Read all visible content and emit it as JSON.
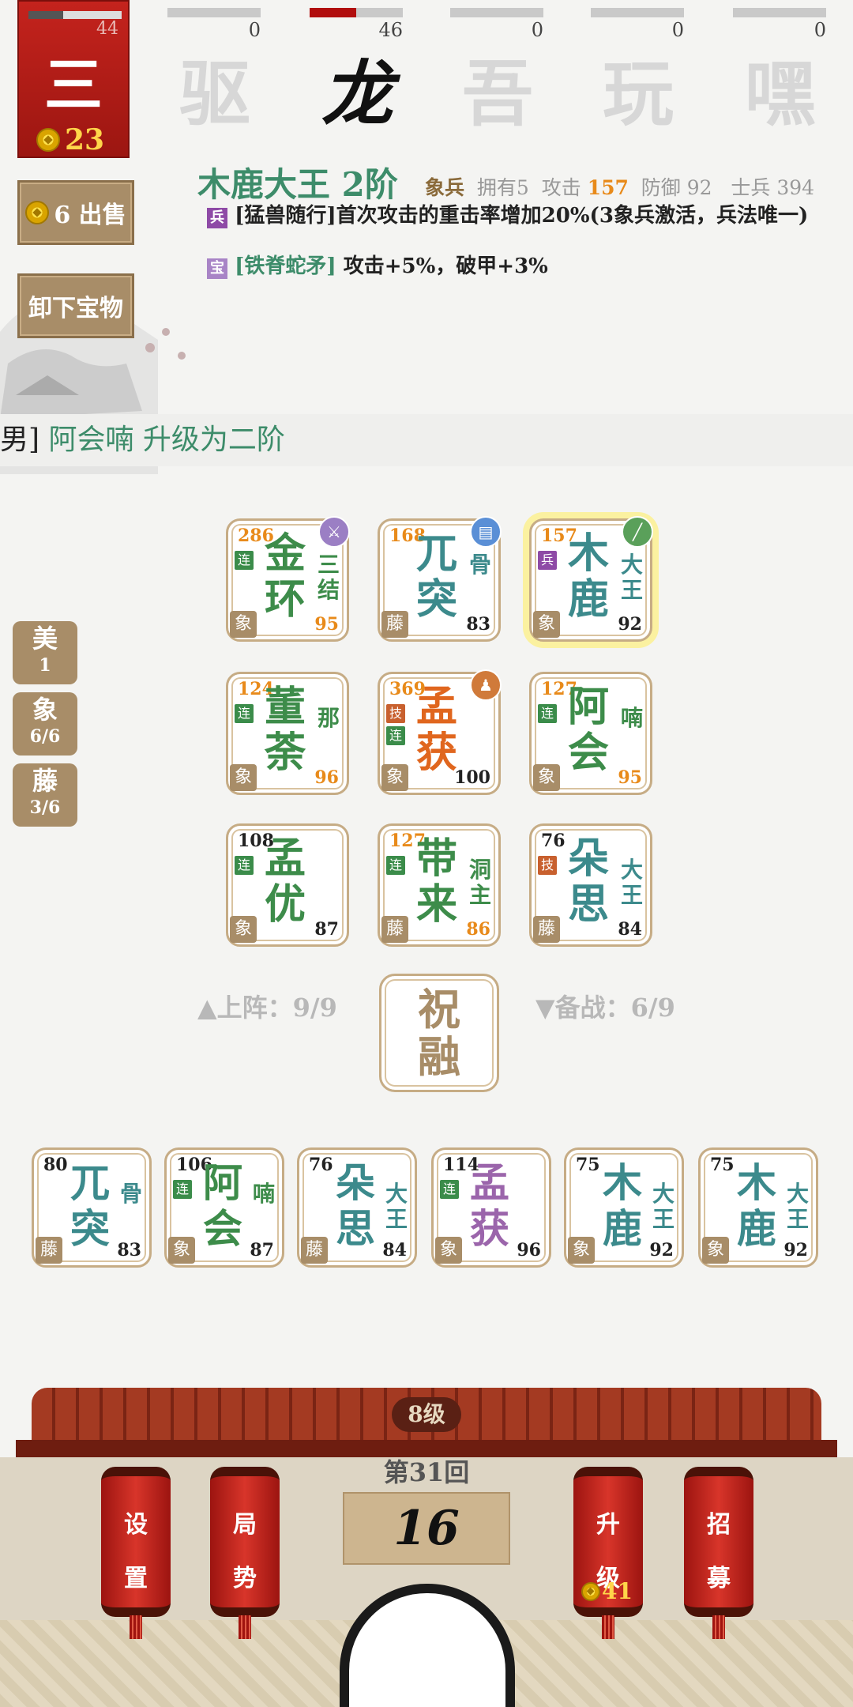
{
  "player": {
    "name": "三",
    "hp": "44",
    "hp_ratio": 0.37,
    "gold": "23"
  },
  "opponents": [
    {
      "name": "驱",
      "hp": "0",
      "hp_ratio": 0,
      "active": false
    },
    {
      "name": "龙",
      "hp": "46",
      "hp_ratio": 0.5,
      "active": true
    },
    {
      "name": "吾",
      "hp": "0",
      "hp_ratio": 0,
      "active": false
    },
    {
      "name": "玩",
      "hp": "0",
      "hp_ratio": 0,
      "active": false
    },
    {
      "name": "嘿",
      "hp": "0",
      "hp_ratio": 0,
      "active": false
    }
  ],
  "side_buttons": {
    "sell": "6 出售",
    "unequip": "卸下宝物"
  },
  "unit_info": {
    "title": "木鹿大王 2阶",
    "type_label": "象兵",
    "own_label": "拥有5",
    "atk_label": "攻击",
    "atk": "157",
    "def_label": "防御 92",
    "soldier_label": "士兵 394",
    "skill_tag": "兵",
    "skill_name": "[猛兽随行]",
    "skill_desc": "首次攻击的重击率增加20%(3象兵激活，兵法唯一)",
    "treasure_tag": "宝",
    "treasure_name": "[铁脊蛇矛]",
    "treasure_desc": " 攻击+5%，破甲+3%"
  },
  "notice": {
    "prefix": "男]",
    "text": " 阿会喃 升级为二阶"
  },
  "filters": [
    {
      "name": "美",
      "count": "1"
    },
    {
      "name": "象",
      "count": "6/6"
    },
    {
      "name": "藤",
      "count": "3/6"
    }
  ],
  "board": [
    {
      "atk": "286",
      "n1": "金",
      "n2": "环",
      "sub": "三结",
      "hp": "95",
      "cls": "象",
      "tags": [
        "连"
      ],
      "color": "green",
      "badge": "⚔",
      "badge_color": "#9b7fc4"
    },
    {
      "atk": "168",
      "n1": "兀",
      "n2": "突",
      "sub": "骨",
      "hp": "83",
      "cls": "藤",
      "tags": [],
      "color": "teal",
      "badge": "▤",
      "badge_color": "#5a8fd6"
    },
    {
      "atk": "157",
      "n1": "木",
      "n2": "鹿",
      "sub": "大王",
      "hp": "92",
      "cls": "象",
      "tags": [
        "兵"
      ],
      "color": "teal",
      "badge": "╱",
      "badge_color": "#5aa05a",
      "selected": true
    },
    {
      "atk": "124",
      "n1": "董",
      "n2": "荼",
      "sub": "那",
      "hp": "96",
      "cls": "象",
      "tags": [
        "连"
      ],
      "color": "green"
    },
    {
      "atk": "369",
      "n1": "孟",
      "n2": "获",
      "sub": "",
      "hp": "100",
      "cls": "象",
      "tags": [
        "技",
        "连"
      ],
      "color": "orange",
      "badge": "♟",
      "badge_color": "#d07a3a"
    },
    {
      "atk": "127",
      "n1": "阿",
      "n2": "会",
      "sub": "喃",
      "hp": "95",
      "cls": "象",
      "tags": [
        "连"
      ],
      "color": "green"
    },
    {
      "atk": "108",
      "n1": "孟",
      "n2": "优",
      "sub": "",
      "hp": "87",
      "cls": "象",
      "tags": [
        "连"
      ],
      "color": "green"
    },
    {
      "atk": "127",
      "n1": "带",
      "n2": "来",
      "sub": "洞主",
      "hp": "86",
      "cls": "藤",
      "tags": [
        "连"
      ],
      "color": "green"
    },
    {
      "atk": "76",
      "n1": "朵",
      "n2": "思",
      "sub": "大王",
      "hp": "84",
      "cls": "藤",
      "tags": [
        "技"
      ],
      "color": "teal"
    }
  ],
  "deploy_label": "▲上阵：9/9",
  "reserve_label": "▼备战：6/9",
  "boss": {
    "n1": "祝",
    "n2": "融"
  },
  "bench": [
    {
      "atk": "80",
      "n1": "兀",
      "n2": "突",
      "sub": "骨",
      "hp": "83",
      "cls": "藤",
      "tags": [],
      "color": "teal"
    },
    {
      "atk": "106",
      "n1": "阿",
      "n2": "会",
      "sub": "喃",
      "hp": "87",
      "cls": "象",
      "tags": [
        "连"
      ],
      "color": "green"
    },
    {
      "atk": "76",
      "n1": "朵",
      "n2": "思",
      "sub": "大王",
      "hp": "84",
      "cls": "藤",
      "tags": [],
      "color": "teal"
    },
    {
      "atk": "114",
      "n1": "孟",
      "n2": "获",
      "sub": "",
      "hp": "96",
      "cls": "象",
      "tags": [
        "连"
      ],
      "color": "purple"
    },
    {
      "atk": "75",
      "n1": "木",
      "n2": "鹿",
      "sub": "大王",
      "hp": "92",
      "cls": "象",
      "tags": [],
      "color": "teal"
    },
    {
      "atk": "75",
      "n1": "木",
      "n2": "鹿",
      "sub": "大王",
      "hp": "92",
      "cls": "象",
      "tags": [],
      "color": "teal"
    }
  ],
  "bottom": {
    "level": "8级",
    "round": "第31回",
    "timer": "16",
    "settings": [
      "设",
      "置"
    ],
    "situation": [
      "局",
      "势"
    ],
    "upgrade": [
      "升",
      "级"
    ],
    "upgrade_cost": "41",
    "recruit": [
      "招",
      "募"
    ]
  }
}
